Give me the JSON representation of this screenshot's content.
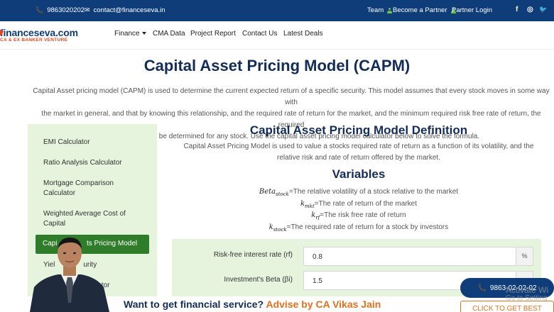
{
  "topbar": {
    "phone": "9863020202",
    "email": "contact@financeseva.in",
    "links": [
      "Team",
      "Become a Partner",
      "Partner Login"
    ],
    "social": [
      "f",
      "◎",
      "🐦"
    ]
  },
  "logo": {
    "name": "financeseva.com",
    "tagline": "CA & EX BANKER VENTURE"
  },
  "nav": {
    "items": [
      "Finance",
      "CMA Data",
      "Project Report",
      "Contact Us",
      "Latest Deals"
    ]
  },
  "page": {
    "title": "Capital Asset Pricing Model (CAPM)",
    "intro_lines": [
      "Capital Asset pricing model (CAPM) is used to determine the current expected return of a specific security. This model assumes that every stock moves in some way with",
      "the market in general, and that by knowing this relationship, and the required rate of return for the market, and the minimum required risk free rate of return, the required",
      "rate of return can be determined for any stock. Use the capital asset pricing model calculator below to solve the formula."
    ]
  },
  "sidebar": {
    "items": [
      "EMI Calculator",
      "Ratio Analysis Calculator",
      "Mortgage Comparison Calculator",
      "Weighted Average Cost of Capital",
      "Capital Assets Pricing Model",
      "Yield to Maturity",
      "Loan Calculator"
    ],
    "active_label": "Capital Assets Pricing Model",
    "visible": [
      "EMI Calculator",
      "Ratio Analysis Calculator",
      "Mortgage Comparison",
      "Calculator",
      "Weighted Average Cost of",
      "Capital",
      "Capi",
      "ts Pricing Model",
      "Yiel",
      "urity",
      "lator"
    ]
  },
  "definition": {
    "title": "Capital Asset Pricing Model Definition",
    "lines": [
      "Capital Asset Pricing Model is used to value a stocks required rate of return as a function of its volatility, and the",
      "relative risk and rate of return offered by the market."
    ]
  },
  "variables": {
    "title": "Variables",
    "items": [
      {
        "sym": "Beta",
        "sub": "stock",
        "desc": "=The relative volatility of a stock relative to the market"
      },
      {
        "sym": "k",
        "sub": "mkt",
        "desc": "=The rate of return of the market"
      },
      {
        "sym": "k",
        "sub": "rf",
        "desc": "=The risk free rate of return"
      },
      {
        "sym": "k",
        "sub": "stock",
        "desc": "=The required rate of return for a stock by investors"
      }
    ]
  },
  "calculator": {
    "rf_label": "Risk-free interest rate (rf)",
    "rf_value": "0.8",
    "rf_unit": "%",
    "beta_label": "Investment's Beta (βi)",
    "beta_value": "1.5"
  },
  "banner": {
    "text": "Want to get financial service?",
    "accent": "Advise by CA Vikas Jain"
  },
  "floating": {
    "phone": "9863-02-02-02",
    "deals": "CLICK TO GET BEST DEALS"
  },
  "watermark": {
    "line1": "Activate Wi",
    "line2": "Go to Setting"
  },
  "colors": {
    "navy": "#0f3d7a",
    "green_active": "#2f7d2a",
    "panel_green": "#e6f3dd",
    "orange": "#e0711e"
  }
}
